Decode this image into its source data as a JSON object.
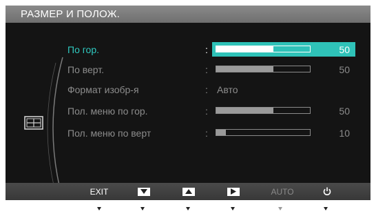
{
  "title": "РАЗМЕР И ПОЛОЖ.",
  "menu": [
    {
      "label": "По гор.",
      "type": "slider",
      "value": 50,
      "active": true
    },
    {
      "label": "По верт.",
      "type": "slider",
      "value": 50,
      "active": false
    },
    {
      "label": "Формат изобр-я",
      "type": "option",
      "value_text": "Авто",
      "active": false
    },
    {
      "label": "Пол. меню по гор.",
      "type": "slider",
      "value": 50,
      "active": false
    },
    {
      "label": "Пол. меню по верт",
      "type": "slider",
      "value": 10,
      "active": false
    }
  ],
  "colon": ":",
  "category_icon": "size-position-icon",
  "buttons": [
    {
      "label": "EXIT",
      "icon": "exit",
      "enabled": true
    },
    {
      "label": "",
      "icon": "down-arrow-icon",
      "enabled": true
    },
    {
      "label": "",
      "icon": "up-arrow-icon",
      "enabled": true
    },
    {
      "label": "",
      "icon": "enter-arrow-icon",
      "enabled": true
    },
    {
      "label": "AUTO",
      "icon": "auto",
      "enabled": false
    },
    {
      "label": "",
      "icon": "power-icon",
      "enabled": true
    }
  ],
  "colors": {
    "accent": "#2fc2b8",
    "active_label": "#2fc9c0",
    "inactive": "#8c8c8c",
    "background": "#141414",
    "titlebar": "#7d7d7d"
  }
}
